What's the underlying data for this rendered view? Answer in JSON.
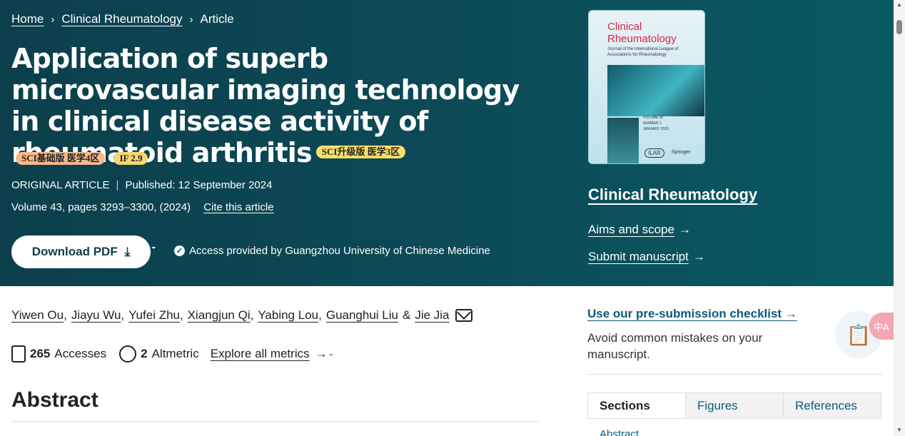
{
  "breadcrumb": {
    "home": "Home",
    "journal": "Clinical Rheumatology",
    "current": "Article",
    "separator": "›"
  },
  "article": {
    "title": "Application of superb microvascular imaging technology in clinical disease activity of rheumatoid arthritis",
    "badge_inline": "SCI升级版 医学3区",
    "badge_basic": "SCI基础版 医学4区",
    "badge_if": "IF 2.9",
    "type": "ORIGINAL ARTICLE",
    "published": "Published: 12 September 2024",
    "volume": "Volume 43, pages 3293–3300, (2024)",
    "cite": "Cite this article",
    "download": "Download PDF",
    "access": "Access provided by Guangzhou University of Chinese Medicine"
  },
  "cover": {
    "title_line1": "Clinical",
    "title_line2": "Rheumatology",
    "subtitle": "Journal of the International League of Associations for Rheumatology",
    "volume": "VOLUME 39",
    "number": "NUMBER 1",
    "date": "JANUARY 2020",
    "ilar": "ILAR",
    "publisher": "Springer"
  },
  "sidebar": {
    "journal_name": "Clinical Rheumatology",
    "aims": "Aims and scope",
    "submit": "Submit manuscript",
    "arrow": "→",
    "checklist": "Use our pre-submission checklist",
    "checklist_desc": "Avoid common mistakes on your manuscript.",
    "tabs": [
      "Sections",
      "Figures",
      "References"
    ],
    "peek": "Abstract"
  },
  "authors": [
    "Yiwen Ou",
    "Jiayu Wu",
    "Yufei Zhu",
    "Xiangjun Qi",
    "Yabing Lou",
    "Guanghui Liu",
    "Jie Jia"
  ],
  "authors_amp": "&",
  "metrics": {
    "accesses_count": "265",
    "accesses_label": "Accesses",
    "altmetric_count": "2",
    "altmetric_label": "Altmetric",
    "explore": "Explore all metrics",
    "arrow": "→"
  },
  "abstract_heading": "Abstract",
  "translate_label": "中A",
  "colors": {
    "hero": "#0c4a57",
    "link": "#0c5a7a",
    "badge_yellow": "#f7df6a",
    "badge_orange": "#f6b98a"
  }
}
